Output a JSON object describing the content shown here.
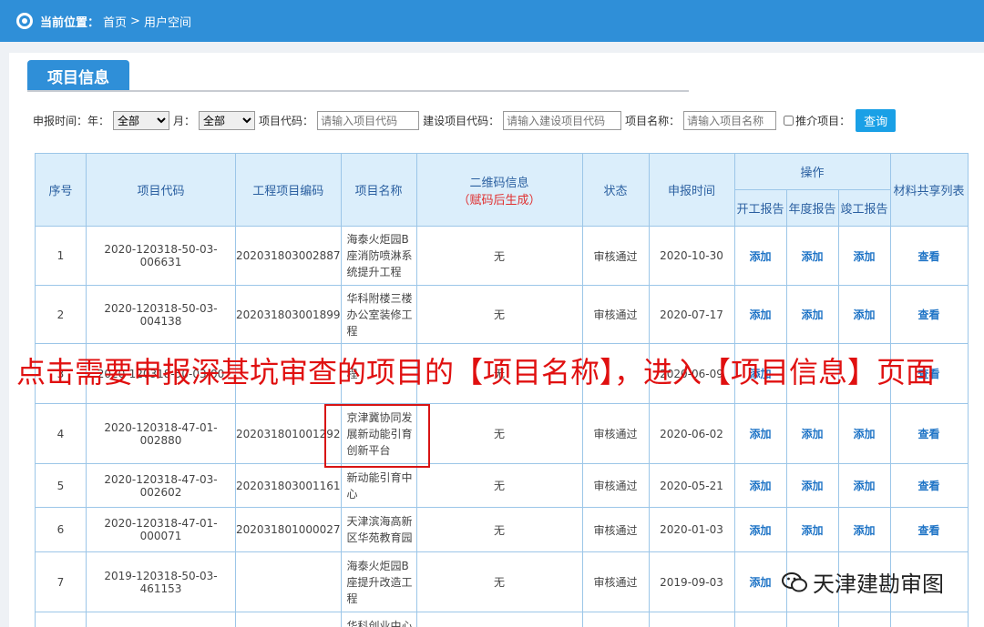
{
  "breadcrumb": {
    "label": "当前位置：",
    "home": "首页",
    "sep": ">",
    "current": "用户空间"
  },
  "tab": {
    "title": "项目信息"
  },
  "filters": {
    "date_label": "申报时间：",
    "year_label": "年：",
    "year_value": "全部",
    "month_label": "月：",
    "month_value": "全部",
    "code_label": "项目代码：",
    "code_placeholder": "请输入项目代码",
    "build_code_label": "建设项目代码：",
    "build_code_placeholder": "请输入建设项目代码",
    "name_label": "项目名称：",
    "name_placeholder": "请输入项目名称",
    "recommend_label": "推介项目：",
    "query_button": "查询"
  },
  "table": {
    "headers": {
      "seq": "序号",
      "code": "项目代码",
      "eng_code": "工程项目编码",
      "name": "项目名称",
      "qr": "二维码信息",
      "qr_note": "（赋码后生成）",
      "status": "状态",
      "date": "申报时间",
      "ops": "操作",
      "op_start": "开工报告",
      "op_year": "年度报告",
      "op_done": "竣工报告",
      "share": "材料共享列表"
    },
    "rows": [
      {
        "seq": "1",
        "code": "2020-120318-50-03-006631",
        "eng": "202031803002887",
        "name": "海泰火炬园B座消防喷淋系统提升工程",
        "qr": "无",
        "status": "审核通过",
        "date": "2020-10-30",
        "a1": "添加",
        "a2": "添加",
        "a3": "添加",
        "view": "查看"
      },
      {
        "seq": "2",
        "code": "2020-120318-50-03-004138",
        "eng": "202031803001899",
        "name": "华科附楼三楼办公室装修工程",
        "qr": "无",
        "status": "审核通过",
        "date": "2020-07-17",
        "a1": "添加",
        "a2": "添加",
        "a3": "添加",
        "view": "查看"
      },
      {
        "seq": "3",
        "code": "2020-120318-50-03-00",
        "eng": "",
        "name": "程",
        "qr": "无",
        "status": "",
        "date": "2020-06-09",
        "a1": "添加",
        "a2": "",
        "a3": "",
        "view": "查看"
      },
      {
        "seq": "4",
        "code": "2020-120318-47-01-002880",
        "eng": "202031801001292",
        "name": "京津冀协同发展新动能引育创新平台",
        "qr": "无",
        "status": "审核通过",
        "date": "2020-06-02",
        "a1": "添加",
        "a2": "添加",
        "a3": "添加",
        "view": "查看"
      },
      {
        "seq": "5",
        "code": "2020-120318-47-03-002602",
        "eng": "202031803001161",
        "name": "新动能引育中心",
        "qr": "无",
        "status": "审核通过",
        "date": "2020-05-21",
        "a1": "添加",
        "a2": "添加",
        "a3": "添加",
        "view": "查看"
      },
      {
        "seq": "6",
        "code": "2020-120318-47-01-000071",
        "eng": "202031801000027",
        "name": "天津滨海高新区华苑教育园",
        "qr": "无",
        "status": "审核通过",
        "date": "2020-01-03",
        "a1": "添加",
        "a2": "添加",
        "a3": "添加",
        "view": "查看"
      },
      {
        "seq": "7",
        "code": "2019-120318-50-03-461153",
        "eng": "",
        "name": "海泰火炬园B座提升改造工程",
        "qr": "无",
        "status": "审核通过",
        "date": "2019-09-03",
        "a1": "添加",
        "a2": "",
        "a3": "",
        "view": ""
      },
      {
        "seq": "",
        "code": "",
        "eng": "",
        "name": "华科创业中心",
        "qr": "",
        "status": "",
        "date": "",
        "a1": "",
        "a2": "",
        "a3": "",
        "view": ""
      }
    ]
  },
  "annotation": "点击需要申报深基坑审查的项目的【项目名称】，进入【项目信息】页面",
  "watermark": "天津建勘审图"
}
